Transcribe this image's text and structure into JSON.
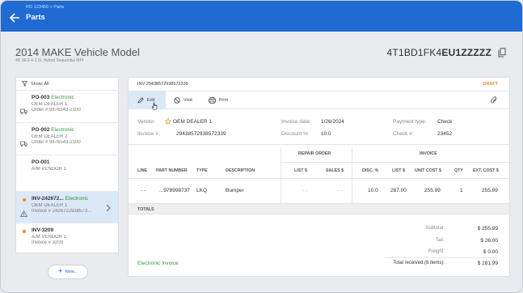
{
  "header": {
    "breadcrumb": "RO 123456 > Parts",
    "title": "Parts",
    "accent_color": "#1f6ad3"
  },
  "vehicle": {
    "title": "2014 MAKE Vehicle Model",
    "subtitle": "4D SES 4-2.5L Hybrid Sequential MPI",
    "vin_prefix": "4T1BD1FK4",
    "vin_suffix": "EU1ZZZZZ"
  },
  "sidebar": {
    "show_all": "Show: All",
    "items": [
      {
        "title": "PO-003",
        "tag": "Electronic",
        "line1": "OEM DEALER 1",
        "line2": "Order # 9876543-2100",
        "icon": "truck-icon"
      },
      {
        "title": "PO-002",
        "tag": "Electronic",
        "line1": "OEM DEALER 2",
        "line2": "Order # 9876543-2100",
        "icon": "truck-icon"
      },
      {
        "title": "PO-001",
        "tag": "",
        "line1": "A/M VENDOR 1",
        "line2": "",
        "icon": ""
      },
      {
        "title": "INV-242672...",
        "tag": "Electronic",
        "line1": "OEM DEALER 1",
        "line2": "Invoice # 2426722938573...",
        "icon": "warning-icon"
      },
      {
        "title": "INV-3209",
        "tag": "",
        "line1": "A/M VENDOR 1",
        "line2": "Invoice # 3209",
        "icon": ""
      }
    ],
    "new_label": "New..."
  },
  "invoice": {
    "id": "INV-29438572938572339",
    "status": "DRAFT",
    "toolbar": {
      "edit": "Edit",
      "void": "Void",
      "print": "Print"
    },
    "vendor_label": "Vendor:",
    "vendor": "OEM DEALER 1",
    "invoice_no_label": "Invoice #:",
    "invoice_no": "29438572938572339",
    "invoice_date_label": "Invoice date:",
    "invoice_date": "1/26/2024",
    "discount_label": "Discount %",
    "discount": "10.0",
    "payment_type_label": "Payment type:",
    "payment_type": "Check",
    "check_no_label": "Check #:",
    "check_no": "23452",
    "group_repair": "REPAIR ORDER",
    "group_invoice": "INVOICE",
    "columns": [
      "LINE",
      "PART NUMBER",
      "TYPE",
      "DESCRIPTION",
      "LIST $",
      "SALES $",
      "DISC. %",
      "LIST $",
      "UNIT COST $",
      "QTY",
      "EXT. COST $"
    ],
    "row": [
      "- -",
      "...978998737",
      "LKQ",
      "Bumper",
      "- -",
      "- -",
      "10.0",
      "287.00",
      "255.99",
      "1",
      "255.99"
    ],
    "totals_header": "TOTALS",
    "subtotal_label": "Subtotal:",
    "subtotal": "$ 255.99",
    "tax_label": "Tax:",
    "tax": "$ 26.00",
    "freight_label": "Freight:",
    "freight": "$ 0.00",
    "total_label": "Total received (8 items):",
    "total": "$ 281.99",
    "electronic": "Electronic invoice"
  }
}
